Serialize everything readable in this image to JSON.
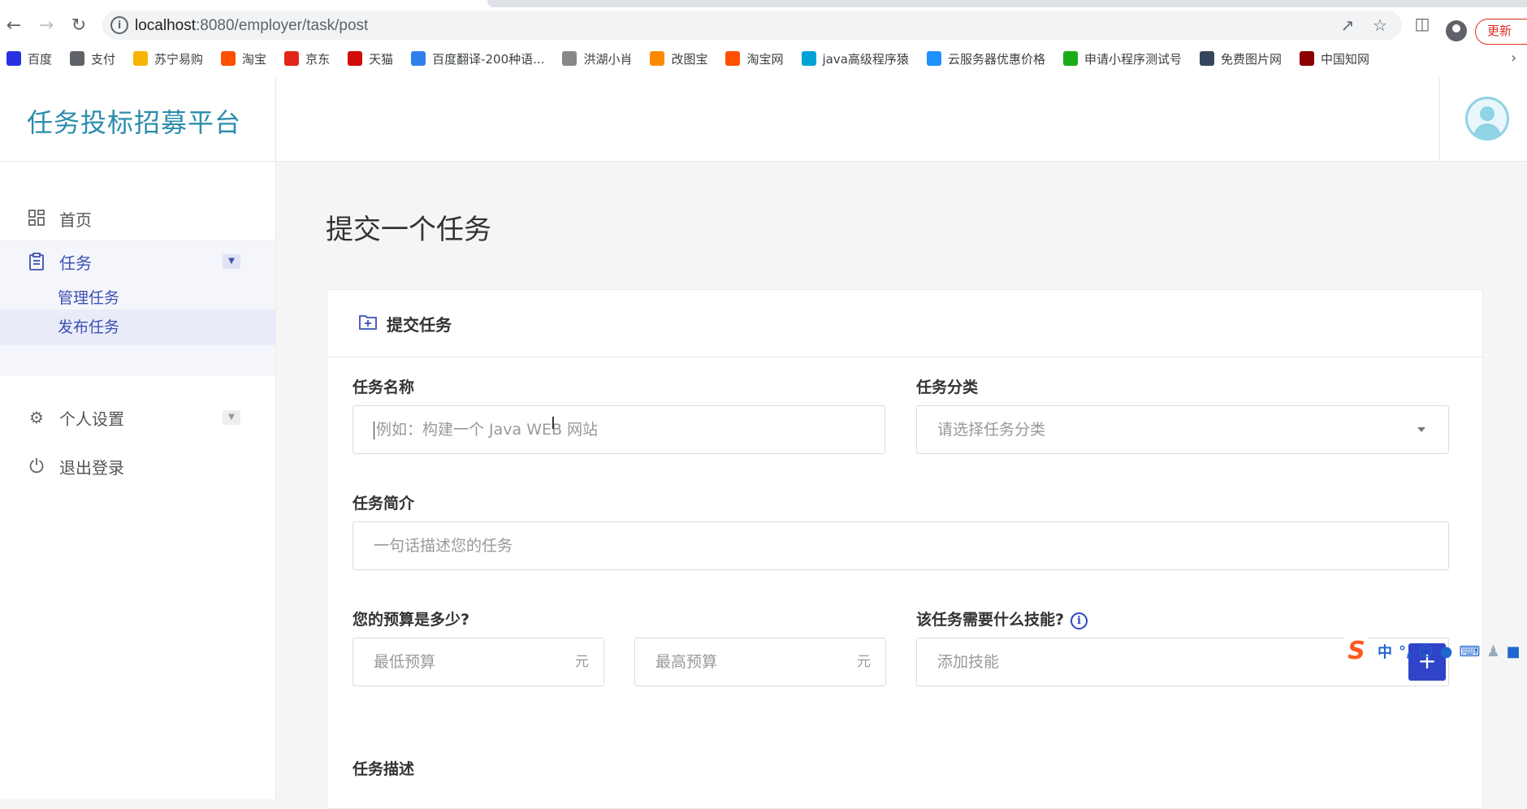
{
  "browser": {
    "url_host": "localhost",
    "url_path": ":8080/employer/task/post",
    "update_label": "更新",
    "bookmarks": [
      {
        "label": "百度",
        "icon": "baidu-icon",
        "color": "#2932e1"
      },
      {
        "label": "支付",
        "icon": "globe-icon",
        "color": "#5f6368"
      },
      {
        "label": "苏宁易购",
        "icon": "suning-icon",
        "color": "#f7b500"
      },
      {
        "label": "淘宝",
        "icon": "taobao-icon",
        "color": "#ff5000"
      },
      {
        "label": "京东",
        "icon": "jd-icon",
        "color": "#e1251b"
      },
      {
        "label": "天猫",
        "icon": "tmall-icon",
        "color": "#d20b0b"
      },
      {
        "label": "百度翻译-200种语...",
        "icon": "translate-icon",
        "color": "#2f80ed"
      },
      {
        "label": "洪湖小肖",
        "icon": "bird-icon",
        "color": "#888888"
      },
      {
        "label": "改图宝",
        "icon": "gaitubao-icon",
        "color": "#ff8a00"
      },
      {
        "label": "淘宝网",
        "icon": "taobao-icon",
        "color": "#ff5000"
      },
      {
        "label": "java高级程序猿",
        "icon": "bilibili-icon",
        "color": "#00a1d6"
      },
      {
        "label": "云服务器优惠价格",
        "icon": "cloud-icon",
        "color": "#1e90ff"
      },
      {
        "label": "申请小程序测试号",
        "icon": "wechat-icon",
        "color": "#1aad19"
      },
      {
        "label": "免费图片网",
        "icon": "tumblr-icon",
        "color": "#35465c"
      },
      {
        "label": "中国知网",
        "icon": "cnki-icon",
        "color": "#8b0000"
      }
    ]
  },
  "app": {
    "brand": "任务投标招募平台",
    "sidebar": {
      "home": "首页",
      "task": "任务",
      "task_sub": [
        "管理任务",
        "发布任务"
      ],
      "settings": "个人设置",
      "logout": "退出登录"
    },
    "page_title": "提交一个任务",
    "card_title": "提交任务",
    "form": {
      "name_label": "任务名称",
      "name_placeholder": "例如：构建一个 Java WEB 网站",
      "category_label": "任务分类",
      "category_placeholder": "请选择任务分类",
      "intro_label": "任务简介",
      "intro_placeholder": "一句话描述您的任务",
      "budget_label": "您的预算是多少?",
      "budget_min_placeholder": "最低预算",
      "budget_max_placeholder": "最高预算",
      "currency": "元",
      "skills_label": "该任务需要什么技能?",
      "skills_placeholder": "添加技能",
      "desc_label": "任务描述"
    }
  },
  "ime": {
    "logo": "S",
    "mode": "中",
    "punct": "°,"
  },
  "colors": {
    "brand": "#2c8dac",
    "accent": "#3c50b4",
    "button": "#2f44c8"
  }
}
